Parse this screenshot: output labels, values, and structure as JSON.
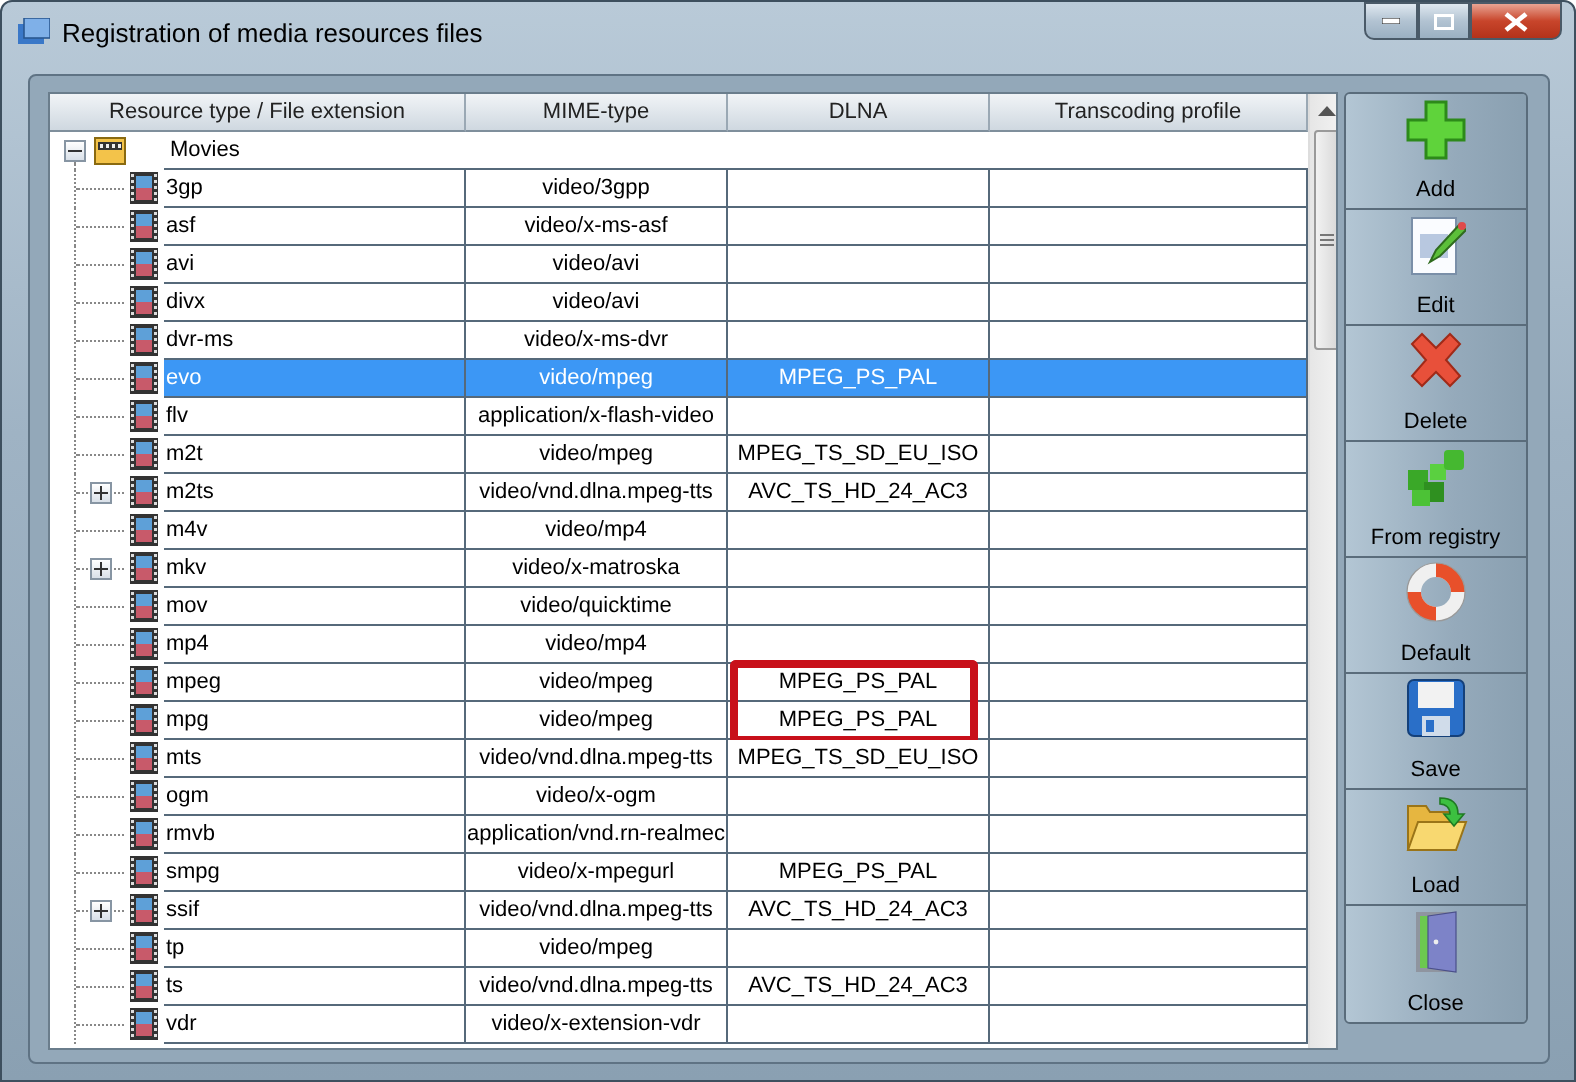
{
  "window": {
    "title": "Registration of media resources files"
  },
  "table": {
    "columns": [
      "Resource type / File extension",
      "MIME-type",
      "DLNA",
      "Transcoding profile"
    ],
    "groups": [
      {
        "label": "Movies",
        "expanded": true,
        "children": [
          {
            "extension": "3gp",
            "mime": "video/3gpp",
            "collapsed": false,
            "selected": false,
            "highlighted": false
          },
          {
            "extension": "asf",
            "mime": "video/x-ms-asf",
            "collapsed": false,
            "selected": false,
            "highlighted": false
          },
          {
            "extension": "avi",
            "mime": "video/avi",
            "collapsed": false,
            "selected": false,
            "highlighted": false
          },
          {
            "extension": "divx",
            "mime": "video/avi",
            "collapsed": false,
            "selected": false,
            "highlighted": false
          },
          {
            "extension": "dvr-ms",
            "mime": "video/x-ms-dvr",
            "collapsed": false,
            "selected": false,
            "highlighted": false
          },
          {
            "extension": "evo",
            "mime": "video/mpeg",
            "dlna": "MPEG_PS_PAL",
            "collapsed": false,
            "selected": true,
            "highlighted": false
          },
          {
            "extension": "flv",
            "mime": "application/x-flash-video",
            "collapsed": false,
            "selected": false,
            "highlighted": false
          },
          {
            "extension": "m2t",
            "mime": "video/mpeg",
            "dlna": "MPEG_TS_SD_EU_ISO",
            "collapsed": false,
            "selected": false,
            "highlighted": false
          },
          {
            "extension": "m2ts",
            "mime": "video/vnd.dlna.mpeg-tts",
            "dlna": "AVC_TS_HD_24_AC3",
            "collapsed": true,
            "selected": false,
            "highlighted": false
          },
          {
            "extension": "m4v",
            "mime": "video/mp4",
            "collapsed": false,
            "selected": false,
            "highlighted": false
          },
          {
            "extension": "mkv",
            "mime": "video/x-matroska",
            "collapsed": true,
            "selected": false,
            "highlighted": false
          },
          {
            "extension": "mov",
            "mime": "video/quicktime",
            "collapsed": false,
            "selected": false,
            "highlighted": false
          },
          {
            "extension": "mp4",
            "mime": "video/mp4",
            "collapsed": false,
            "selected": false,
            "highlighted": false
          },
          {
            "extension": "mpeg",
            "mime": "video/mpeg",
            "dlna": "MPEG_PS_PAL",
            "collapsed": false,
            "selected": false,
            "highlighted": true
          },
          {
            "extension": "mpg",
            "mime": "video/mpeg",
            "dlna": "MPEG_PS_PAL",
            "collapsed": false,
            "selected": false,
            "highlighted": true
          },
          {
            "extension": "mts",
            "mime": "video/vnd.dlna.mpeg-tts",
            "dlna": "MPEG_TS_SD_EU_ISO",
            "collapsed": false,
            "selected": false,
            "highlighted": false
          },
          {
            "extension": "ogm",
            "mime": "video/x-ogm",
            "collapsed": false,
            "selected": false,
            "highlighted": false
          },
          {
            "extension": "rmvb",
            "mime": "application/vnd.rn-realmec",
            "collapsed": false,
            "selected": false,
            "highlighted": false
          },
          {
            "extension": "smpg",
            "mime": "video/x-mpegurl",
            "dlna": "MPEG_PS_PAL",
            "collapsed": false,
            "selected": false,
            "highlighted": false
          },
          {
            "extension": "ssif",
            "mime": "video/vnd.dlna.mpeg-tts",
            "dlna": "AVC_TS_HD_24_AC3",
            "collapsed": true,
            "selected": false,
            "highlighted": false
          },
          {
            "extension": "tp",
            "mime": "video/mpeg",
            "collapsed": false,
            "selected": false,
            "highlighted": false
          },
          {
            "extension": "ts",
            "mime": "video/vnd.dlna.mpeg-tts",
            "dlna": "AVC_TS_HD_24_AC3",
            "collapsed": false,
            "selected": false,
            "highlighted": false
          },
          {
            "extension": "vdr",
            "mime": "video/x-extension-vdr",
            "collapsed": false,
            "selected": false,
            "highlighted": false
          }
        ]
      }
    ]
  },
  "buttons": [
    {
      "label": "Add",
      "kind": "add"
    },
    {
      "label": "Edit",
      "kind": "edit"
    },
    {
      "label": "Delete",
      "kind": "delete"
    },
    {
      "label": "From registry",
      "kind": "registry"
    },
    {
      "label": "Default",
      "kind": "default"
    },
    {
      "label": "Save",
      "kind": "save"
    },
    {
      "label": "Load",
      "kind": "load"
    },
    {
      "label": "Close",
      "kind": "close"
    }
  ]
}
